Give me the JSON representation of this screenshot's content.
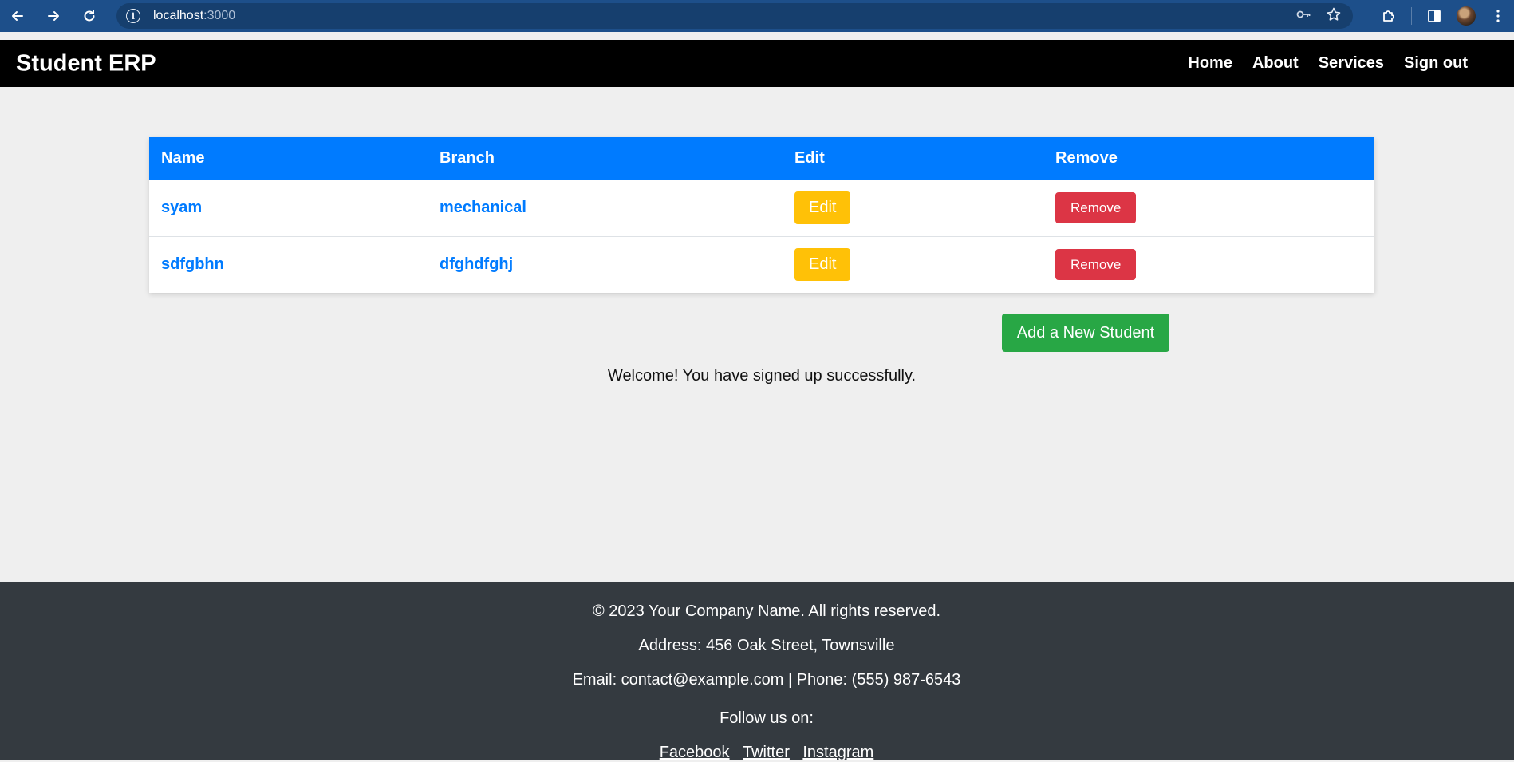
{
  "browser": {
    "url_host": "localhost",
    "url_port": ":3000"
  },
  "header": {
    "brand": "Student ERP",
    "nav": [
      "Home",
      "About",
      "Services",
      "Sign out"
    ]
  },
  "table": {
    "headers": [
      "Name",
      "Branch",
      "Edit",
      "Remove"
    ],
    "rows": [
      {
        "name": "syam",
        "branch": "mechanical",
        "edit": "Edit",
        "remove": "Remove"
      },
      {
        "name": "sdfgbhn",
        "branch": "dfghdfghj",
        "edit": "Edit",
        "remove": "Remove"
      }
    ]
  },
  "actions": {
    "add_label": "Add a New Student"
  },
  "message": "Welcome! You have signed up successfully.",
  "footer": {
    "copyright": "© 2023 Your Company Name. All rights reserved.",
    "address": "Address: 456 Oak Street, Townsville",
    "contact": "Email: contact@example.com | Phone: (555) 987-6543",
    "follow": "Follow us on:",
    "social": [
      "Facebook",
      "Twitter",
      "Instagram"
    ]
  },
  "colors": {
    "primary": "#007bff",
    "warning": "#ffc107",
    "danger": "#dc3545",
    "success": "#28a745",
    "footer_bg": "#343a40",
    "browser_bar": "#1d4f8a"
  }
}
